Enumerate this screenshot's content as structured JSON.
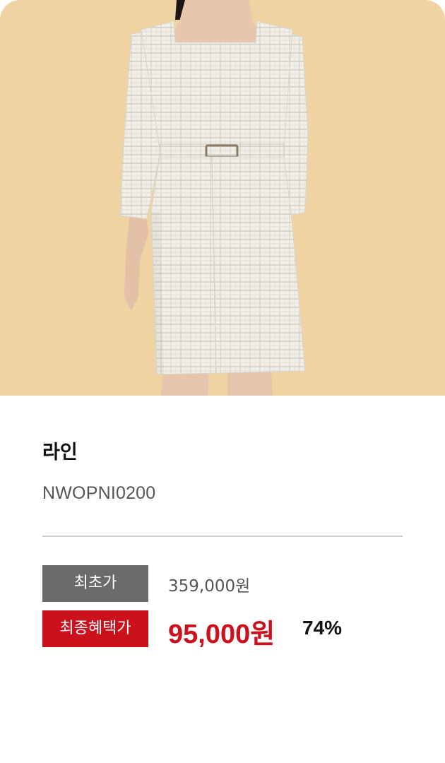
{
  "product": {
    "name": "라인",
    "code": "NWOPNI0200",
    "image_alt": "tweed-dress-photo",
    "background_color": "#f0d3a2"
  },
  "pricing": {
    "original_label": "최초가",
    "original_price": "359,000원",
    "final_label": "최종혜택가",
    "final_price": "95,000원",
    "discount_rate": "74%",
    "accent_color": "#cc111d",
    "gray_badge_color": "#6b6b6b"
  }
}
